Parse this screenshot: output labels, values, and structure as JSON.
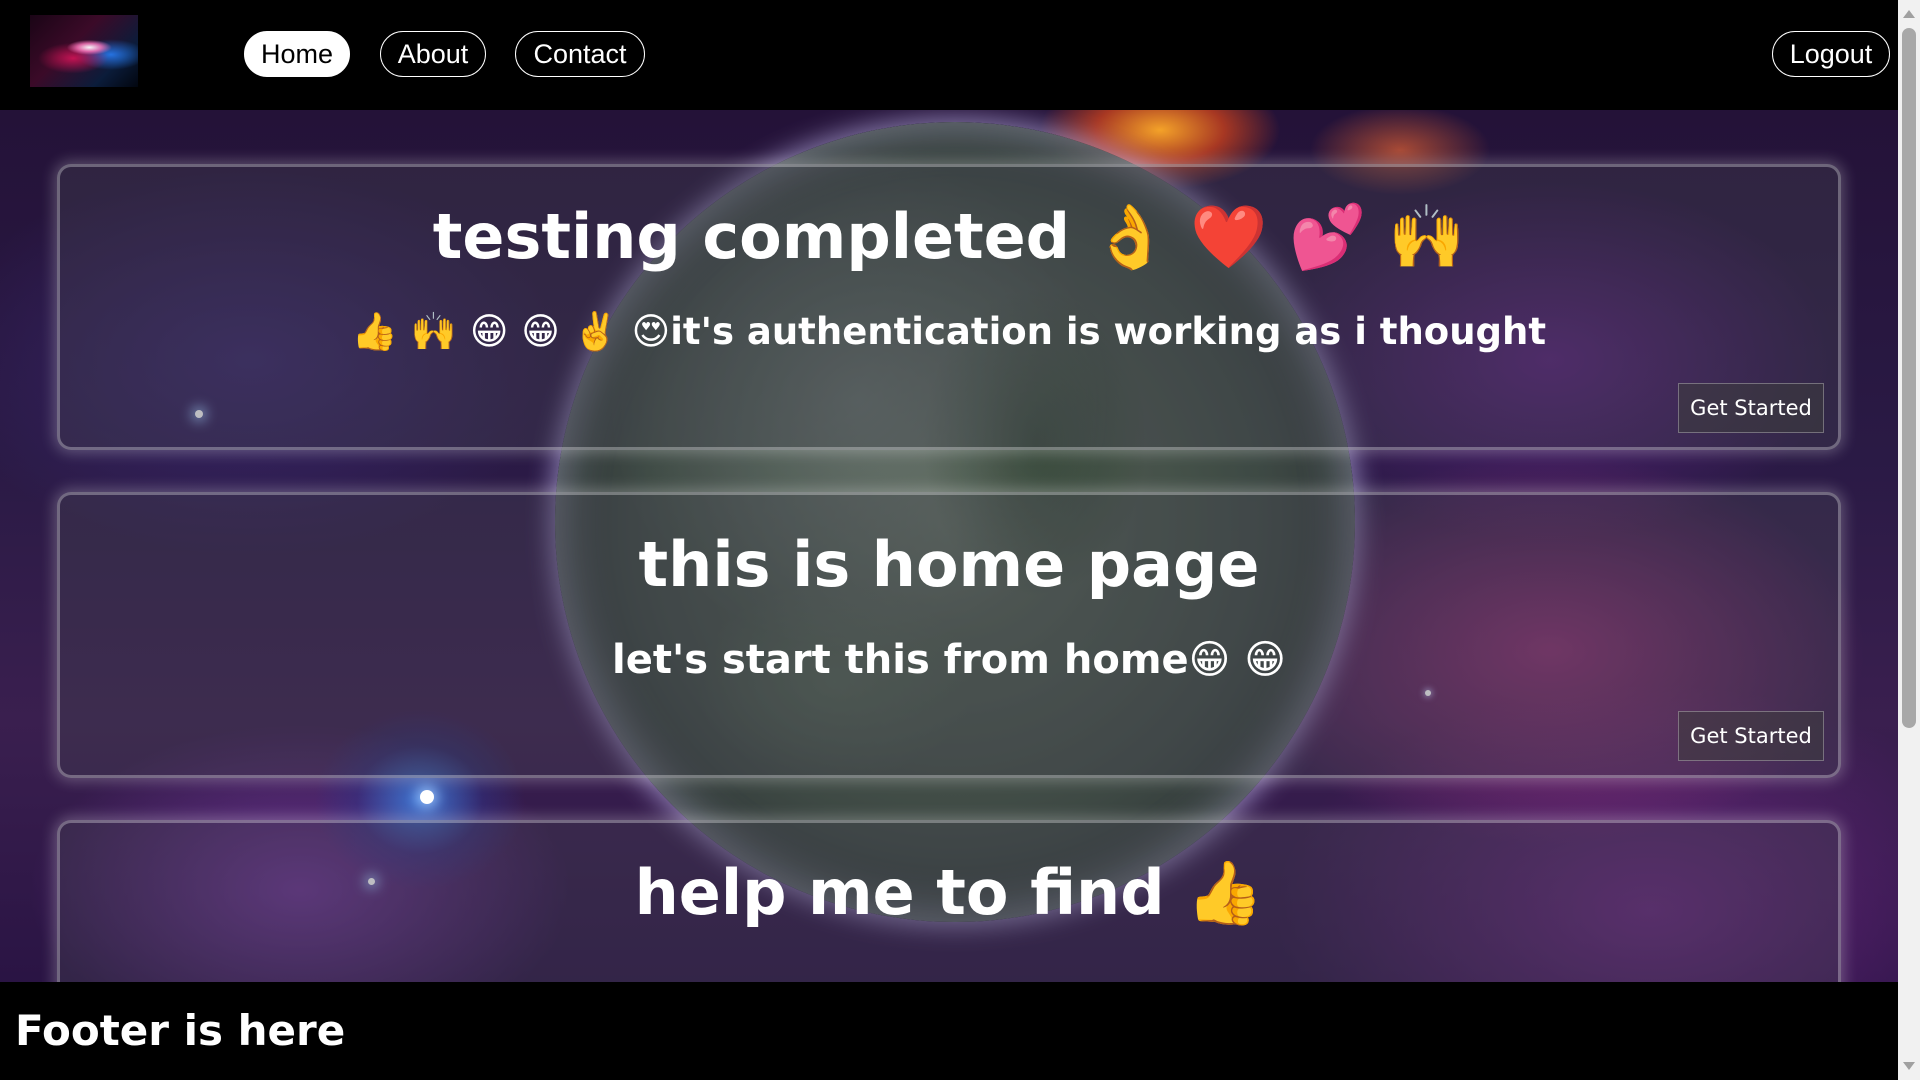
{
  "nav": {
    "logo_icon": "rog-logo-icon",
    "home_label": "Home",
    "about_label": "About",
    "contact_label": "Contact",
    "logout_label": "Logout"
  },
  "background": {
    "image": "galaxy-planet-background"
  },
  "cards": [
    {
      "title": "testing completed 👌 ❤️ 💕 🙌",
      "subtitle": "👍 🙌 😁 😁 ✌️ 😍it's authentication is working as i thought",
      "button_label": "Get Started"
    },
    {
      "title": "this is home page",
      "subtitle": "let's start this from home😁 😁",
      "button_label": "Get Started"
    },
    {
      "title": "help me to find 👍",
      "subtitle": "",
      "button_label": ""
    }
  ],
  "footer": {
    "text": "Footer is here"
  }
}
